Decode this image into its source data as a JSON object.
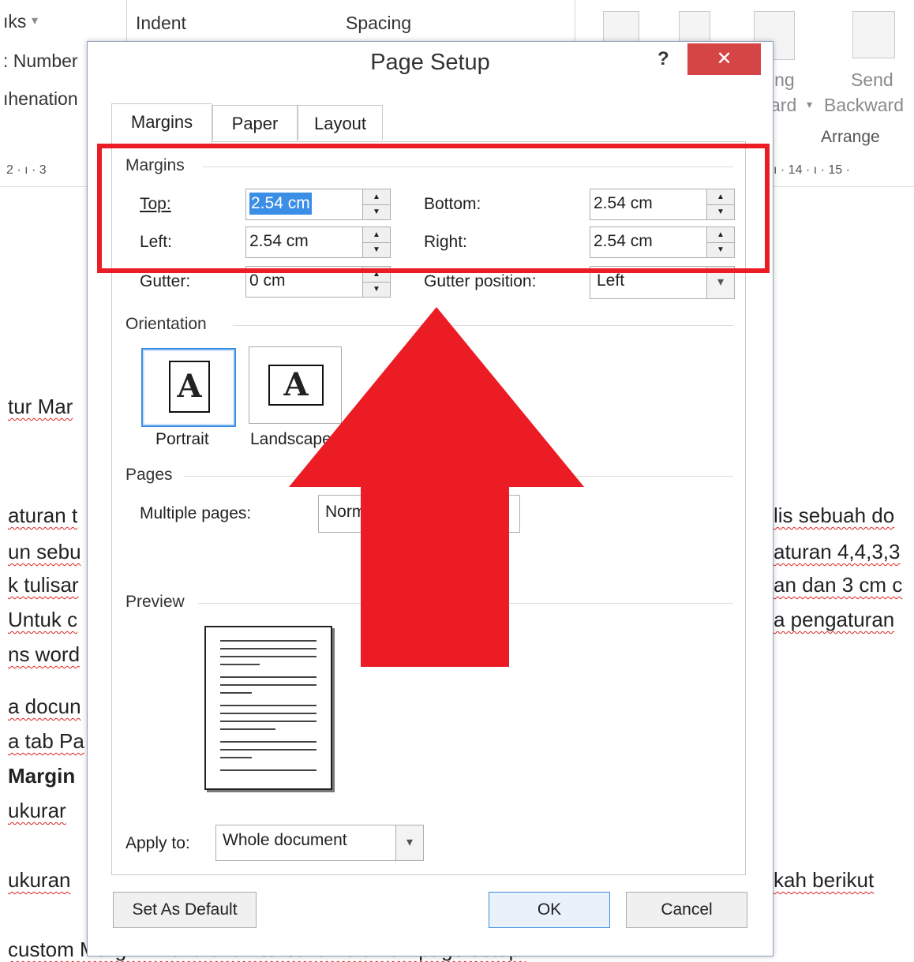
{
  "ribbon": {
    "breaks_label": "ıks",
    "line_numbers_label": ": Number",
    "hyphenation_label": "ıhenation",
    "indent_label": "Indent",
    "spacing_label": "Spacing",
    "wrap_text_fragment": "ing",
    "bring_forward_fragment": "ard",
    "send_backward_line1": "Send",
    "send_backward_line2": "Backward",
    "arrange_label": "Arrange"
  },
  "ruler": {
    "left_text": "2 · ı · 3",
    "right_text": "ı · 14 · ı · 15 ·"
  },
  "document": {
    "lines_left": [
      "tur Mar",
      "aturan t",
      "un sebu",
      "k tulisar",
      " Untuk c",
      "ns word",
      "a docun",
      "a tab Pa",
      "Margin",
      " ukurar",
      "ukuran",
      "custom Margin. Maka akan terbuka halaman page setup."
    ],
    "lines_right": [
      "lis sebuah do",
      "aturan 4,4,3,3",
      "an dan 3 cm c",
      "a pengaturan",
      "kah berikut"
    ]
  },
  "dialog": {
    "title": "Page Setup",
    "help_label": "?",
    "close_label": "✕",
    "tabs": [
      {
        "label": "Margins"
      },
      {
        "label": "Paper"
      },
      {
        "label": "Layout"
      }
    ],
    "margins_group": {
      "title": "Margins",
      "top_label": "Top:",
      "top_value": "2.54 cm",
      "bottom_label": "Bottom:",
      "bottom_value": "2.54 cm",
      "left_label": "Left:",
      "left_value": "2.54 cm",
      "right_label": "Right:",
      "right_value": "2.54 cm",
      "gutter_label": "Gutter:",
      "gutter_value": "0 cm",
      "gutter_position_label": "Gutter position:",
      "gutter_position_value": "Left"
    },
    "orientation_group": {
      "title": "Orientation",
      "portrait_label": "Portrait",
      "landscape_label": "Landscape",
      "page_glyph": "A"
    },
    "pages_group": {
      "title": "Pages",
      "multiple_pages_label": "Multiple pages:",
      "multiple_pages_value": "Normal"
    },
    "preview_group": {
      "title": "Preview"
    },
    "apply_to_label": "Apply to:",
    "apply_to_value": "Whole document",
    "set_default_label": "Set As Default",
    "ok_label": "OK",
    "cancel_label": "Cancel"
  },
  "overlay": {
    "highlight_color": "#ec1c24",
    "arrow_color": "#ec1c24"
  }
}
